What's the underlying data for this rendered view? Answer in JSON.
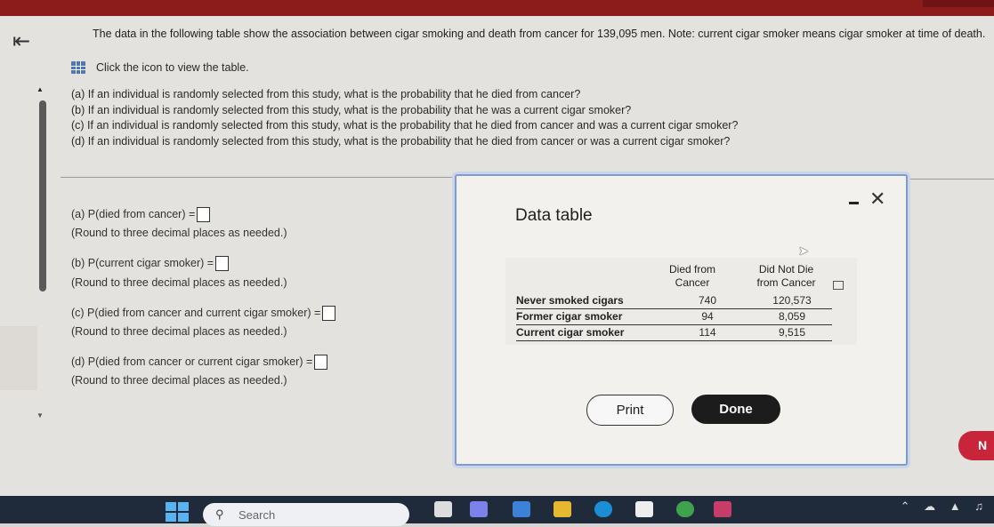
{
  "intro": "The data in the following table show the association between cigar smoking and death from cancer for 139,095 men. Note: current cigar smoker means cigar smoker at time of death.",
  "table_link": "Click the icon to view the table.",
  "questions": [
    "(a) If an individual is randomly selected from this study, what is the probability that he died from cancer?",
    "(b) If an individual is randomly selected from this study, what is the probability that he was a current cigar smoker?",
    "(c) If an individual is randomly selected from this study, what is the probability that he died from cancer and was a current cigar smoker?",
    "(d) If an individual is randomly selected from this study, what is the probability that he died from cancer or was a current cigar smoker?"
  ],
  "answers": [
    {
      "label": "(a) P(died from cancer) =",
      "note": "(Round to three decimal places as needed.)"
    },
    {
      "label": "(b) P(current cigar smoker) =",
      "note": "(Round to three decimal places as needed.)"
    },
    {
      "label": "(c) P(died from cancer and current cigar smoker) =",
      "note": "(Round to three decimal places as needed.)"
    },
    {
      "label": "(d) P(died from cancer or current cigar smoker) =",
      "note": "(Round to three decimal places as needed.)"
    }
  ],
  "modal": {
    "title": "Data table",
    "col1": [
      "Died from",
      "Cancer"
    ],
    "col2": [
      "Did Not Die",
      "from Cancer"
    ],
    "rows": [
      {
        "label": "Never smoked cigars",
        "died": "740",
        "not_died": "120,573"
      },
      {
        "label": "Former cigar smoker",
        "died": "94",
        "not_died": "8,059"
      },
      {
        "label": "Current cigar smoker",
        "died": "114",
        "not_died": "9,515"
      }
    ],
    "print_label": "Print",
    "done_label": "Done"
  },
  "next_label": "N",
  "taskbar": {
    "search_placeholder": "Search"
  }
}
